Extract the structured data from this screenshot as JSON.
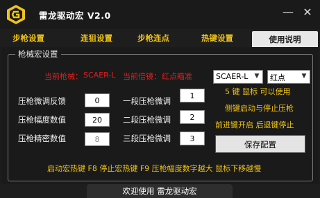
{
  "window": {
    "title": "雷龙驱动宏 V2.0",
    "minimize_glyph": "—",
    "close_glyph": "✕"
  },
  "tabs": [
    {
      "label": "步枪设置",
      "active": false
    },
    {
      "label": "连狙设置",
      "active": false
    },
    {
      "label": "步枪连点",
      "active": false
    },
    {
      "label": "热键设置",
      "active": false
    },
    {
      "label": "使用说明",
      "active": true
    }
  ],
  "group": {
    "label": "枪械宏设置",
    "current_gun_label": "当前枪械：",
    "current_gun_value": "SCAER-L",
    "current_scope_label": "当前倍镜：",
    "current_scope_value": "红点瞄准",
    "gun_select": {
      "value": "SCAER-L"
    },
    "scope_select": {
      "value": "红点"
    },
    "hint_1": "5 键 鼠标 可以使用",
    "hint_2": "侧键启动与停止压枪",
    "hint_3": "前进键开启 后退键停止",
    "save_label": "保存配置",
    "fields": [
      {
        "label": "压枪微调反馈",
        "value": "0"
      },
      {
        "label": "压枪幅度数值",
        "value": "20"
      },
      {
        "label": "压枪精密数值",
        "value": "8"
      }
    ],
    "stages": [
      {
        "label": "一段压枪微调",
        "value": "1"
      },
      {
        "label": "二段压枪微调",
        "value": "2"
      },
      {
        "label": "三段压枪微调",
        "value": "3"
      }
    ],
    "hotkey_note": "启动宏热键 F8 停止宏热键 F9 压枪幅度数字越大 鼠标下移越慢"
  },
  "footer": {
    "label": "欢迎使用 雷龙驱动宏"
  },
  "colors": {
    "accent": "#f0c419",
    "warning": "#e02020",
    "background": "#1a1a1a"
  },
  "icons": {
    "logo": "dragon-g-logo-icon"
  }
}
